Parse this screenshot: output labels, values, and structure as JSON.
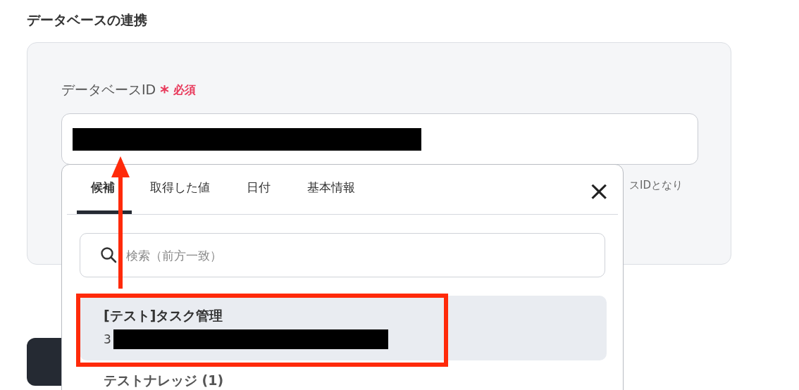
{
  "section_title": "データベースの連携",
  "field": {
    "label": "データベースID",
    "required_mark": "*",
    "required_text": "必須",
    "value_redacted": true,
    "helper_text": "スIDとなり"
  },
  "popup": {
    "tabs": [
      {
        "label": "候補",
        "selected": true
      },
      {
        "label": "取得した値",
        "selected": false
      },
      {
        "label": "日付",
        "selected": false
      },
      {
        "label": "基本情報",
        "selected": false
      }
    ],
    "close": "×",
    "search": {
      "placeholder": "検索（前方一致）"
    },
    "items": [
      {
        "title": "[テスト]タスク管理",
        "subtitle": "3",
        "redacted": true,
        "selected": true
      },
      {
        "title": "テストナレッジ (1)",
        "selected": false
      }
    ]
  }
}
